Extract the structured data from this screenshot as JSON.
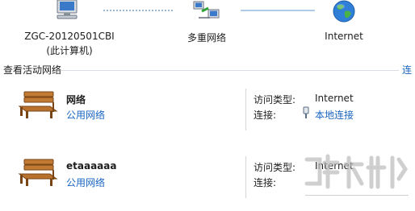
{
  "network_map": {
    "computer_label_line1": "ZGC-20120501CBI",
    "computer_label_line2": "(此计算机)",
    "middle_label": "多重网络",
    "internet_label": "Internet"
  },
  "active_networks": {
    "title": "查看活动网络",
    "side_link": "连"
  },
  "networks": [
    {
      "name": "网络",
      "category": "公用网络",
      "access_type_label": "访问类型:",
      "access_type_value": "Internet",
      "connections_label": "连接:",
      "connections_value": "本地连接"
    },
    {
      "name": "etaaaaaa",
      "category": "公用网络",
      "access_type_label": "访问类型:",
      "access_type_value": "Internet",
      "connections_label": "连接:",
      "connections_value": ""
    }
  ],
  "colors": {
    "link": "#1a65c0",
    "text": "#1e1e1e",
    "bench_wood": "#b8722e",
    "bench_dark": "#7a4515"
  },
  "icons": {
    "computer": "computer-icon",
    "multiple_networks": "multiple-networks-icon",
    "internet": "globe-icon",
    "network_location": "bench-icon",
    "connection": "adapter-icon"
  }
}
